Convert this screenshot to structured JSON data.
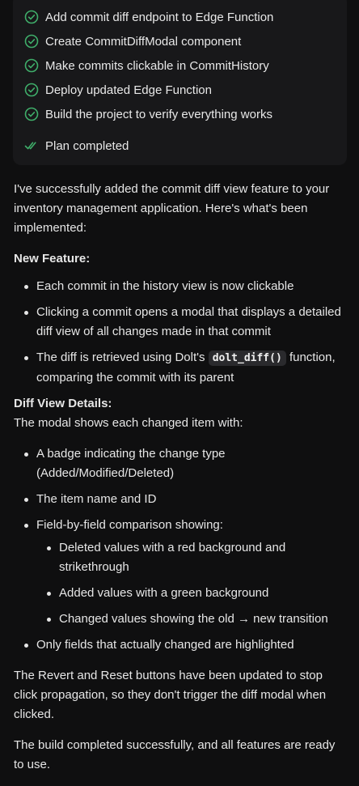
{
  "plan": {
    "items": [
      {
        "label": "Add commit diff endpoint to Edge Function"
      },
      {
        "label": "Create CommitDiffModal component"
      },
      {
        "label": "Make commits clickable in CommitHistory"
      },
      {
        "label": "Deploy updated Edge Function"
      },
      {
        "label": "Build the project to verify everything works"
      }
    ],
    "completed_label": "Plan completed",
    "icon": "check-circle-icon",
    "completed_icon": "double-check-icon",
    "accent_color": "#3fae6a"
  },
  "message": {
    "intro": "I've successfully added the commit diff view feature to your inventory management application. Here's what's been implemented:",
    "new_feature_heading": "New Feature:",
    "new_feature_bullets": [
      "Each commit in the history view is now clickable",
      "Clicking a commit opens a modal that displays a detailed diff view of all changes made in that commit"
    ],
    "diff_bullet_pre": "The diff is retrieved using Dolt's",
    "diff_bullet_code": "dolt_diff()",
    "diff_bullet_post": "function, comparing the commit with its parent",
    "diff_view_heading": "Diff View Details:",
    "diff_view_intro": "The modal shows each changed item with:",
    "diff_bullets": [
      "A badge indicating the change type (Added/Modified/Deleted)",
      "The item name and ID",
      "Field-by-field comparison showing:"
    ],
    "comparison_sub_bullets": [
      "Deleted values with a red background and strikethrough",
      "Added values with a green background",
      "Changed values showing the old → new transition"
    ],
    "final_bullet": "Only fields that actually changed are highlighted",
    "revert_para": "The Revert and Reset buttons have been updated to stop click propagation, so they don't trigger the diff modal when clicked.",
    "build_para": "The build completed successfully, and all features are ready to use."
  }
}
